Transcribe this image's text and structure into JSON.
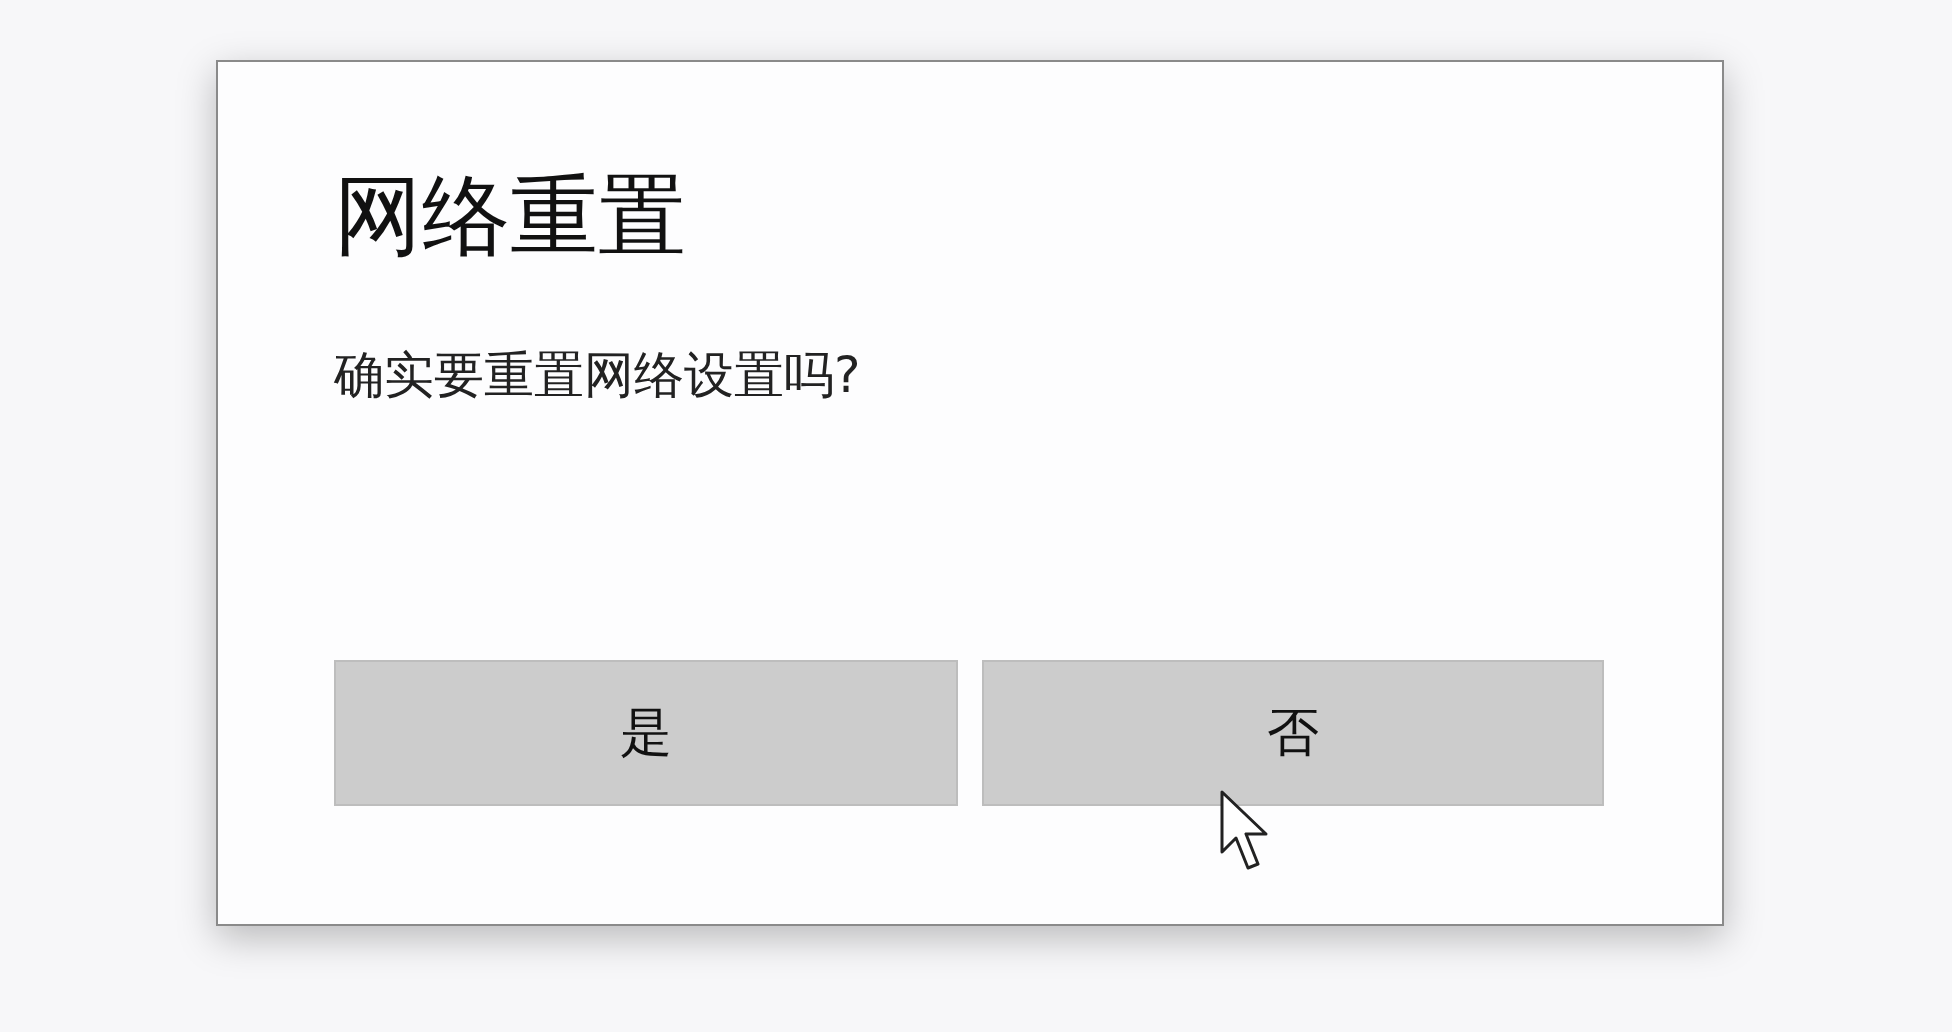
{
  "dialog": {
    "title": "网络重置",
    "message": "确实要重置网络设置吗?",
    "buttons": [
      {
        "label": "是"
      },
      {
        "label": "否"
      }
    ]
  }
}
